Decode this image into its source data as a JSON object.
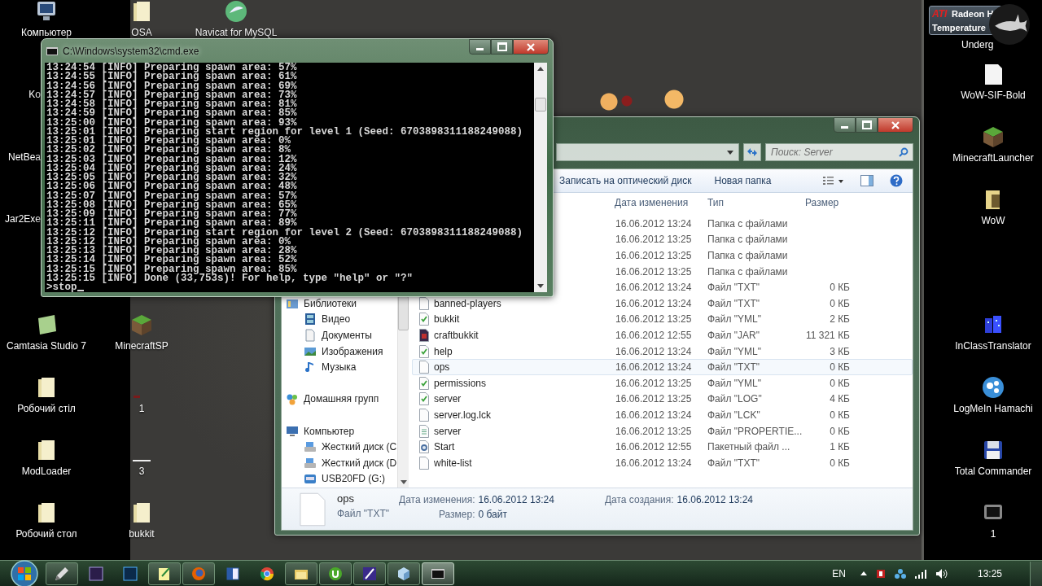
{
  "desktop_icons": [
    {
      "label": "Компьютер",
      "kind": "computer"
    },
    {
      "label": "OSA",
      "kind": "folder"
    },
    {
      "label": "Navicat for MySQL",
      "kind": "navicat"
    },
    {
      "label": "Ko",
      "kind": "label_only"
    },
    {
      "label": "NetBea",
      "kind": "label_only"
    },
    {
      "label": "Jar2Exe",
      "kind": "label_only"
    },
    {
      "label": "Camtasia Studio 7",
      "kind": "camtasia"
    },
    {
      "label": "MinecraftSP",
      "kind": "minecraft"
    },
    {
      "label": "Робочий стіл",
      "kind": "folder"
    },
    {
      "label": "1",
      "kind": "mark"
    },
    {
      "label": "ModLoader",
      "kind": "folder"
    },
    {
      "label": "3",
      "kind": "line"
    },
    {
      "label": "Робочий стол",
      "kind": "folder"
    },
    {
      "label": "bukkit",
      "kind": "folder"
    }
  ],
  "right_icons": [
    {
      "label": "Underg",
      "kind": "label_only"
    },
    {
      "label": "WoW-SIF-Bold",
      "kind": "file"
    },
    {
      "label": "MinecraftLauncher",
      "kind": "minecraft"
    },
    {
      "label": "WoW",
      "kind": "folder"
    },
    {
      "label": "InClassTranslator",
      "kind": "translator"
    },
    {
      "label": "LogMeIn Hamachi",
      "kind": "hamachi"
    },
    {
      "label": "Total Commander",
      "kind": "floppy"
    },
    {
      "label": "1",
      "kind": "monitor"
    }
  ],
  "gadget": {
    "logo": "ATI",
    "title": "Radeon H",
    "subtitle": "Temperature"
  },
  "cmd": {
    "title": "C:\\Windows\\system32\\cmd.exe",
    "lines": [
      "13:24:54 [INFO] Preparing spawn area: 57%",
      "13:24:55 [INFO] Preparing spawn area: 61%",
      "13:24:56 [INFO] Preparing spawn area: 69%",
      "13:24:57 [INFO] Preparing spawn area: 73%",
      "13:24:58 [INFO] Preparing spawn area: 81%",
      "13:24:59 [INFO] Preparing spawn area: 85%",
      "13:25:00 [INFO] Preparing spawn area: 93%",
      "13:25:01 [INFO] Preparing start region for level 1 (Seed: 6703898311188249088)",
      "13:25:01 [INFO] Preparing spawn area: 0%",
      "13:25:02 [INFO] Preparing spawn area: 8%",
      "13:25:03 [INFO] Preparing spawn area: 12%",
      "13:25:04 [INFO] Preparing spawn area: 24%",
      "13:25:05 [INFO] Preparing spawn area: 32%",
      "13:25:06 [INFO] Preparing spawn area: 48%",
      "13:25:07 [INFO] Preparing spawn area: 57%",
      "13:25:08 [INFO] Preparing spawn area: 65%",
      "13:25:09 [INFO] Preparing spawn area: 77%",
      "13:25:11 [INFO] Preparing spawn area: 89%",
      "13:25:12 [INFO] Preparing start region for level 2 (Seed: 6703898311188249088)",
      "13:25:12 [INFO] Preparing spawn area: 0%",
      "13:25:13 [INFO] Preparing spawn area: 28%",
      "13:25:14 [INFO] Preparing spawn area: 52%",
      "13:25:15 [INFO] Preparing spawn area: 85%",
      "13:25:15 [INFO] Done (33,753s)! For help, type \"help\" or \"?\""
    ],
    "input": ">stop"
  },
  "explorer": {
    "search": {
      "placeholder": "Поиск: Server"
    },
    "toolbar": [
      "Записать на оптический диск",
      "Новая папка"
    ],
    "columns": [
      "Дата изменения",
      "Тип",
      "Размер"
    ],
    "sidebar": [
      {
        "label": "Библиотеки",
        "kind": "library",
        "children": [
          {
            "label": "Видео",
            "kind": "video"
          },
          {
            "label": "Документы",
            "kind": "docs"
          },
          {
            "label": "Изображения",
            "kind": "images"
          },
          {
            "label": "Музыка",
            "kind": "music"
          }
        ]
      },
      {
        "label": "Домашняя групп",
        "kind": "homegroup"
      },
      {
        "label": "Компьютер",
        "kind": "computer",
        "children": [
          {
            "label": "Жесткий диск (C",
            "kind": "hdd"
          },
          {
            "label": "Жесткий диск (D",
            "kind": "hdd"
          },
          {
            "label": "USB20FD (G:)",
            "kind": "usb"
          }
        ]
      }
    ],
    "files": [
      {
        "date": "16.06.2012 13:24",
        "type": "Папка с файлами",
        "selected": false
      },
      {
        "date": "16.06.2012 13:25",
        "type": "Папка с файлами",
        "selected": false
      },
      {
        "date": "16.06.2012 13:25",
        "type": "Папка с файлами",
        "selected": false
      },
      {
        "date": "16.06.2012 13:25",
        "type": "Папка с файлами",
        "selected": false
      },
      {
        "date": "16.06.2012 13:24",
        "type": "Файл \"TXT\"",
        "size": "0 КБ",
        "selected": false
      },
      {
        "name": "banned-players",
        "kind": "txt",
        "date": "16.06.2012 13:24",
        "type": "Файл \"TXT\"",
        "size": "0 КБ",
        "selected": false
      },
      {
        "name": "bukkit",
        "kind": "yml",
        "date": "16.06.2012 13:25",
        "type": "Файл \"YML\"",
        "size": "2 КБ",
        "selected": false
      },
      {
        "name": "craftbukkit",
        "kind": "jar",
        "date": "16.06.2012 12:55",
        "type": "Файл \"JAR\"",
        "size": "11 321 КБ",
        "selected": false
      },
      {
        "name": "help",
        "kind": "yml",
        "date": "16.06.2012 13:24",
        "type": "Файл \"YML\"",
        "size": "3 КБ",
        "selected": false
      },
      {
        "name": "ops",
        "kind": "txt",
        "date": "16.06.2012 13:24",
        "type": "Файл \"TXT\"",
        "size": "0 КБ",
        "selected": true
      },
      {
        "name": "permissions",
        "kind": "yml",
        "date": "16.06.2012 13:25",
        "type": "Файл \"YML\"",
        "size": "0 КБ",
        "selected": false
      },
      {
        "name": "server",
        "kind": "yml",
        "date": "16.06.2012 13:25",
        "type": "Файл \"LOG\"",
        "size": "4 КБ",
        "selected": false
      },
      {
        "name": "server.log.lck",
        "kind": "txt",
        "date": "16.06.2012 13:24",
        "type": "Файл \"LCK\"",
        "size": "0 КБ",
        "selected": false
      },
      {
        "name": "server",
        "kind": "properties",
        "date": "16.06.2012 13:25",
        "type": "Файл \"PROPERTIE...",
        "size": "0 КБ",
        "selected": false
      },
      {
        "name": "Start",
        "kind": "bat",
        "date": "16.06.2012 12:55",
        "type": "Пакетный файл ...",
        "size": "1 КБ",
        "selected": false
      },
      {
        "name": "white-list",
        "kind": "txt",
        "date": "16.06.2012 13:24",
        "type": "Файл \"TXT\"",
        "size": "0 КБ",
        "selected": false
      }
    ],
    "details": {
      "name": "ops",
      "type": "Файл \"TXT\"",
      "modified_label": "Дата изменения:",
      "modified": "16.06.2012 13:24",
      "size_label": "Размер:",
      "size": "0 байт",
      "created_label": "Дата создания:",
      "created": "16.06.2012 13:24"
    }
  },
  "taskbar": {
    "items": [
      {
        "kind": "pen",
        "running": true,
        "selected": false
      },
      {
        "kind": "ae",
        "running": false,
        "selected": false
      },
      {
        "kind": "ps",
        "running": false,
        "selected": false
      },
      {
        "kind": "notepad",
        "running": true,
        "selected": false
      },
      {
        "kind": "firefox",
        "running": true,
        "selected": false
      },
      {
        "kind": "word",
        "running": false,
        "selected": false
      },
      {
        "kind": "chrome",
        "running": false,
        "selected": false
      },
      {
        "kind": "folder",
        "running": true,
        "selected": false
      },
      {
        "kind": "torrent",
        "running": true,
        "selected": false
      },
      {
        "kind": "feather",
        "running": true,
        "selected": false
      },
      {
        "kind": "cube",
        "running": true,
        "selected": false
      },
      {
        "kind": "cmd",
        "running": true,
        "selected": true
      }
    ],
    "language": "EN",
    "clock": "13:25"
  }
}
